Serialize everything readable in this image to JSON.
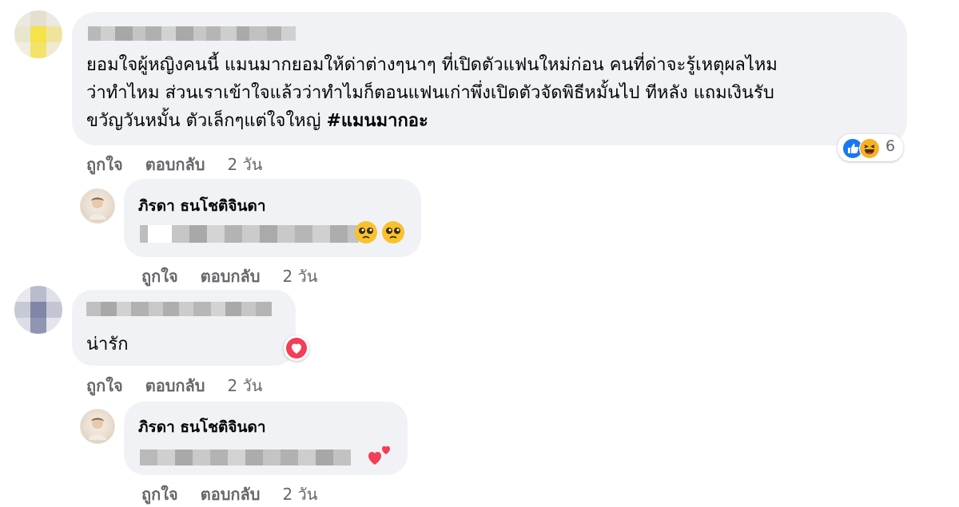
{
  "comments": [
    {
      "text_lines": [
        "ยอมใจผู้หญิงคนนี้ แมนมากยอมให้ด่าต่างๆนาๆ ที่เปิดตัวแฟนใหม่ก่อน คนที่ด่าจะรู้เหตุผลไหม",
        "ว่าทำไหม ส่วนเราเข้าใจแล้วว่าทำไมก็ตอนแฟนเก่าพึ่งเปิดตัวจัดพิธีหมั้นไป ทีหลัง แถมเงินรับ",
        "ขวัญวันหมั้น ตัวเล็กๆแต่ใจใหญ่ "
      ],
      "hashtag": "#แมนมากอะ",
      "reaction_count": "6",
      "reaction_icons": [
        "like-icon",
        "laugh-icon"
      ],
      "actions": {
        "like": "ถูกใจ",
        "reply": "ตอบกลับ",
        "time": "2 วัน"
      },
      "reply": {
        "author": "ภิรดา ธนโชติจินดา",
        "emoji": "🥺🥺",
        "actions": {
          "like": "ถูกใจ",
          "reply": "ตอบกลับ",
          "time": "2 วัน"
        }
      }
    },
    {
      "text": "น่ารัก",
      "reaction_icons": [
        "love-icon"
      ],
      "actions": {
        "like": "ถูกใจ",
        "reply": "ตอบกลับ",
        "time": "2 วัน"
      },
      "reply": {
        "author": "ภิรดา ธนโชติจินดา",
        "emoji": "💕",
        "actions": {
          "like": "ถูกใจ",
          "reply": "ตอบกลับ",
          "time": "2 วัน"
        }
      }
    }
  ],
  "colors": {
    "bubble": "#f0f2f5",
    "secondary_text": "#65676b",
    "like_blue": "#1877f2",
    "love_red": "#f33e58"
  }
}
